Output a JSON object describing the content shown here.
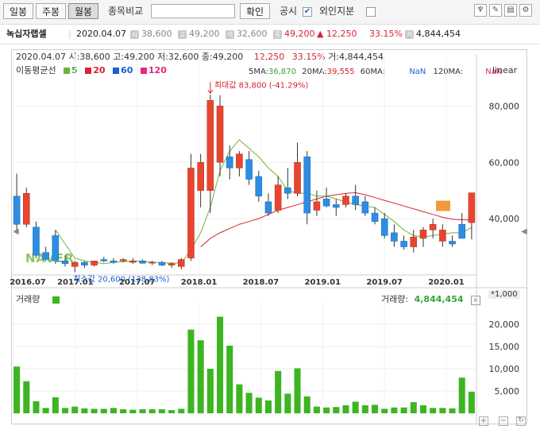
{
  "toolbar": {
    "period_buttons": [
      "일봉",
      "주봉",
      "월봉"
    ],
    "compare_label": "종목비교",
    "search_value": "",
    "confirm_label": "확인",
    "disclosure_label": "공시",
    "disclosure_checked": true,
    "foreign_label": "외인지분",
    "foreign_checked": false
  },
  "stock": {
    "name": "녹십자랩셀",
    "date": "2020.04.07",
    "open_badge": "시",
    "open": "38,600",
    "high_badge": "고",
    "high": "49,200",
    "low_badge": "저",
    "low": "32,600",
    "close_badge": "종",
    "close": "49,200",
    "change": "▲ 12,250",
    "change_pct": "33.15%",
    "volume_badge": "거",
    "volume": "4,844,454"
  },
  "chart_header": {
    "line": "2020.04.07 시:38,600 고:49,200 저:32,600 종:49,200",
    "change": "12,250",
    "change_pct": "33.15%",
    "volume": "거:4,844,454"
  },
  "ma": {
    "label": "이동평균선",
    "periods": [
      "5",
      "20",
      "60",
      "120"
    ],
    "colors": [
      "#6cb33f",
      "#d5262d",
      "#1760d6",
      "#e4287c"
    ],
    "ma5_label": "5MA:",
    "ma5_value": "36,870",
    "ma20_label": "20MA:",
    "ma20_value": "39,555",
    "ma60_label": "60MA:",
    "ma60_value": "NaN",
    "ma120_label": "120MA:",
    "ma120_value": "NaN"
  },
  "scale_label": "linear",
  "volume_panel": {
    "label": "거래량",
    "value_label": "거래량:",
    "value": "4,844,454",
    "unit": "*1,000",
    "close_icon": "close-icon"
  },
  "watermark": "NAVER",
  "max_annotation": "최대값 83,800 (-41.29%)",
  "min_annotation": "최소값 20,600 (138.83%)",
  "chart_data": {
    "type": "candlestick",
    "title": "",
    "x_ticks": [
      "2016.07",
      "2017.01",
      "2017.07",
      "2018.01",
      "2018.07",
      "2019.01",
      "2019.07",
      "2020.01"
    ],
    "y_ticks": [
      40000,
      60000,
      80000
    ],
    "ylim": [
      20000,
      90000
    ],
    "vol_ticks": [
      5000,
      10000,
      15000,
      20000
    ],
    "vol_lim": [
      0,
      25000
    ],
    "grid": true,
    "candles": [
      {
        "o": 48000,
        "h": 56000,
        "l": 36000,
        "c": 38000
      },
      {
        "o": 38000,
        "h": 51000,
        "l": 37000,
        "c": 49000
      },
      {
        "o": 37000,
        "h": 39000,
        "l": 26000,
        "c": 27000
      },
      {
        "o": 28000,
        "h": 30000,
        "l": 25000,
        "c": 25500
      },
      {
        "o": 34000,
        "h": 36000,
        "l": 24000,
        "c": 25000
      },
      {
        "o": 25000,
        "h": 27000,
        "l": 23000,
        "c": 24000
      },
      {
        "o": 23000,
        "h": 25000,
        "l": 21000,
        "c": 24500
      },
      {
        "o": 24500,
        "h": 25000,
        "l": 22500,
        "c": 23500
      },
      {
        "o": 23500,
        "h": 25000,
        "l": 23000,
        "c": 25000
      },
      {
        "o": 25500,
        "h": 26500,
        "l": 24500,
        "c": 25000
      },
      {
        "o": 25000,
        "h": 26000,
        "l": 24000,
        "c": 24500
      },
      {
        "o": 25000,
        "h": 26000,
        "l": 24500,
        "c": 25500
      },
      {
        "o": 24500,
        "h": 26000,
        "l": 24000,
        "c": 25000
      },
      {
        "o": 25000,
        "h": 25500,
        "l": 24000,
        "c": 24200
      },
      {
        "o": 24200,
        "h": 25000,
        "l": 23500,
        "c": 24500
      },
      {
        "o": 24500,
        "h": 25000,
        "l": 23200,
        "c": 23500
      },
      {
        "o": 23500,
        "h": 24500,
        "l": 22500,
        "c": 24000
      },
      {
        "o": 23000,
        "h": 26000,
        "l": 22000,
        "c": 25500
      },
      {
        "o": 26000,
        "h": 63000,
        "l": 25000,
        "c": 58000
      },
      {
        "o": 50000,
        "h": 63000,
        "l": 44000,
        "c": 60000
      },
      {
        "o": 50000,
        "h": 84000,
        "l": 42000,
        "c": 82000
      },
      {
        "o": 60000,
        "h": 83800,
        "l": 55000,
        "c": 80000
      },
      {
        "o": 62000,
        "h": 66000,
        "l": 54000,
        "c": 58000
      },
      {
        "o": 58000,
        "h": 64000,
        "l": 55000,
        "c": 63000
      },
      {
        "o": 61000,
        "h": 64000,
        "l": 52000,
        "c": 54000
      },
      {
        "o": 55000,
        "h": 57000,
        "l": 46000,
        "c": 48000
      },
      {
        "o": 46000,
        "h": 49000,
        "l": 41000,
        "c": 42000
      },
      {
        "o": 43000,
        "h": 55000,
        "l": 42000,
        "c": 52000
      },
      {
        "o": 51000,
        "h": 58000,
        "l": 47000,
        "c": 49000
      },
      {
        "o": 49000,
        "h": 67000,
        "l": 48000,
        "c": 60000
      },
      {
        "o": 62000,
        "h": 64000,
        "l": 38000,
        "c": 42000
      },
      {
        "o": 43000,
        "h": 50000,
        "l": 41000,
        "c": 46000
      },
      {
        "o": 47000,
        "h": 51000,
        "l": 44000,
        "c": 44500
      },
      {
        "o": 45000,
        "h": 47000,
        "l": 41000,
        "c": 44000
      },
      {
        "o": 45000,
        "h": 49000,
        "l": 44000,
        "c": 48000
      },
      {
        "o": 48000,
        "h": 52000,
        "l": 43000,
        "c": 45000
      },
      {
        "o": 46000,
        "h": 48000,
        "l": 41000,
        "c": 42000
      },
      {
        "o": 42000,
        "h": 44000,
        "l": 38000,
        "c": 39000
      },
      {
        "o": 40000,
        "h": 42000,
        "l": 33000,
        "c": 34000
      },
      {
        "o": 35000,
        "h": 38000,
        "l": 30000,
        "c": 32000
      },
      {
        "o": 32000,
        "h": 34000,
        "l": 29000,
        "c": 30000
      },
      {
        "o": 30000,
        "h": 36000,
        "l": 28000,
        "c": 33500
      },
      {
        "o": 33000,
        "h": 37000,
        "l": 30000,
        "c": 36000
      },
      {
        "o": 36000,
        "h": 40000,
        "l": 33000,
        "c": 38000
      },
      {
        "o": 32000,
        "h": 38000,
        "l": 30000,
        "c": 36000
      },
      {
        "o": 32000,
        "h": 34000,
        "l": 30000,
        "c": 31000
      },
      {
        "o": 38000,
        "h": 42000,
        "l": 33000,
        "c": 33000
      },
      {
        "o": 38600,
        "h": 49200,
        "l": 32600,
        "c": 49200
      }
    ],
    "volumes": [
      10500,
      7200,
      2700,
      1200,
      3600,
      1200,
      1500,
      1100,
      1000,
      1000,
      1200,
      900,
      800,
      900,
      900,
      900,
      700,
      1000,
      18800,
      16400,
      10000,
      21700,
      15200,
      6500,
      4600,
      3500,
      2900,
      9500,
      4400,
      10100,
      3800,
      1500,
      1300,
      1400,
      1800,
      2600,
      1800,
      1900,
      1000,
      1300,
      1300,
      2500,
      1800,
      1200,
      1200,
      1100,
      8000,
      4844
    ],
    "ma5": [
      null,
      null,
      null,
      null,
      36000,
      31000,
      26000,
      25000,
      24500,
      24000,
      24500,
      24700,
      25000,
      24800,
      24600,
      24300,
      24200,
      24200,
      29000,
      35000,
      44000,
      57000,
      64000,
      68000,
      65000,
      62000,
      58000,
      55000,
      50000,
      49000,
      49000,
      48000,
      48000,
      47000,
      46000,
      45000,
      44500,
      44000,
      41500,
      39000,
      36000,
      34000,
      33500,
      34000,
      34500,
      35000,
      35000,
      36870
    ],
    "ma20": [
      null,
      null,
      null,
      null,
      null,
      null,
      null,
      null,
      null,
      null,
      null,
      null,
      null,
      null,
      null,
      null,
      null,
      null,
      null,
      30000,
      33000,
      35000,
      36500,
      38000,
      39000,
      40000,
      41500,
      43000,
      44000,
      45000,
      46000,
      47000,
      48000,
      48500,
      49000,
      49200,
      48500,
      47500,
      46500,
      45500,
      44500,
      43500,
      42500,
      41500,
      40500,
      39800,
      39600,
      39555
    ]
  }
}
